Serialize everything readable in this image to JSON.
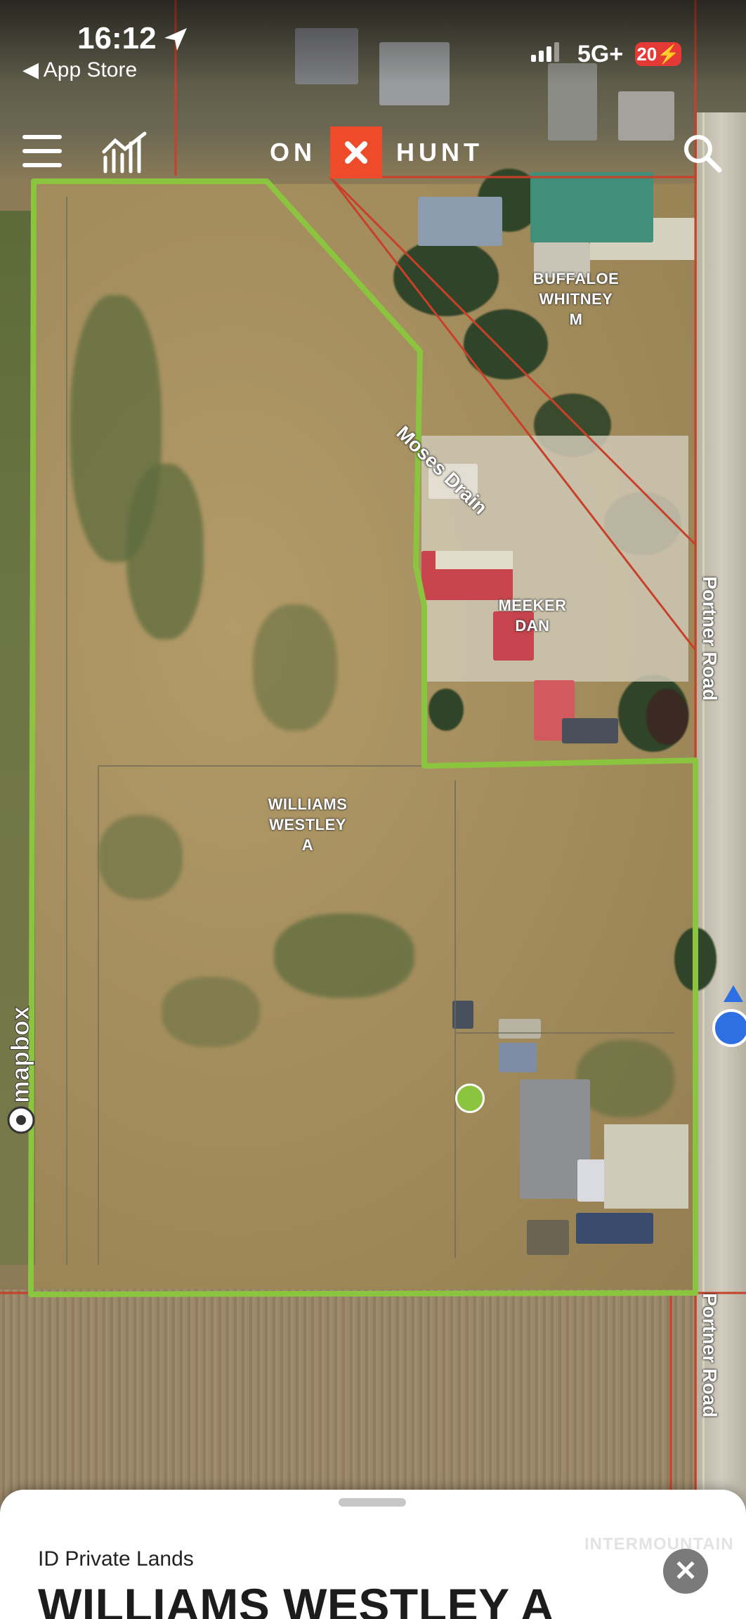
{
  "status_bar": {
    "time": "16:12",
    "back_label": "◀ App Store",
    "network": "5G+",
    "battery": "20"
  },
  "toolbar": {
    "logo_left": "ON",
    "logo_right": "HUNT"
  },
  "map": {
    "attribution": "mapbox",
    "parcels": [
      {
        "owner_line1": "BUFFALOE",
        "owner_line2": "WHITNEY",
        "owner_line3": "M"
      },
      {
        "owner_line1": "MEEKER",
        "owner_line2": "DAN"
      },
      {
        "owner_line1": "WILLIAMS",
        "owner_line2": "WESTLEY",
        "owner_line3": "A",
        "selected": true
      }
    ],
    "roads": [
      "Moses Drain",
      "Portner Road",
      "Portner Road"
    ],
    "colors": {
      "selected_parcel_outline": "#8bc53f",
      "parcel_lines": "#c8402a",
      "user_location": "#2f6fe4",
      "brand": "#ee4b2b"
    }
  },
  "sheet": {
    "subtitle": "ID Private Lands",
    "title": "WILLIAMS WESTLEY A",
    "watermark": "INTERMOUNTAIN"
  }
}
